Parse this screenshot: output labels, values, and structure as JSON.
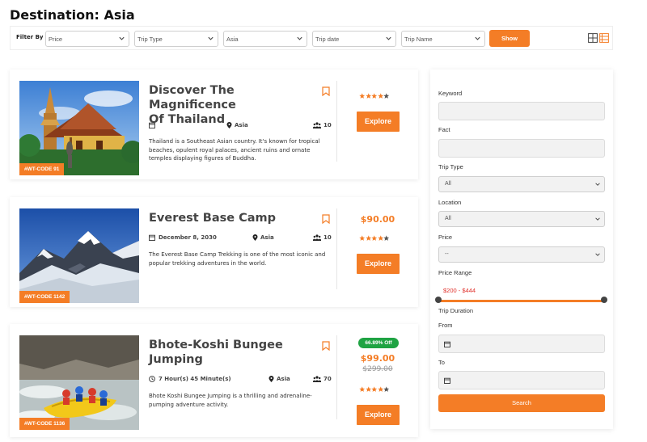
{
  "page": {
    "title": "Destination: Asia"
  },
  "filter_bar": {
    "label": "Filter By",
    "selects": [
      {
        "value": "Price"
      },
      {
        "value": "Trip Type"
      },
      {
        "value": "Asia"
      },
      {
        "value": "Trip date"
      },
      {
        "value": "Trip Name"
      }
    ],
    "show_label": "Show",
    "view_icons": [
      "grid-view-icon",
      "list-view-icon"
    ]
  },
  "colors": {
    "accent": "#f47d26",
    "discount": "#1fa343",
    "range_value": "#e0302a"
  },
  "trips": [
    {
      "title_line1": "Discover The Magnificence",
      "title_line2": "Of Thailand",
      "date": "",
      "location": "Asia",
      "group_size": "10",
      "description": "Thailand is a Southeast Asian country. It's known for tropical beaches, opulent royal palaces, ancient ruins and ornate temples displaying figures of Buddha.",
      "code": "#WT-CODE 91",
      "price": "",
      "old_price": "",
      "discount": "",
      "rating": 4,
      "explore_label": "Explore"
    },
    {
      "title_line1": "Everest Base Camp",
      "title_line2": "",
      "date": "December 8, 2030",
      "location": "Asia",
      "group_size": "10",
      "description": "The Everest Base Camp Trekking is one of the most iconic and popular trekking adventures in the world.",
      "code": "#WT-CODE 1142",
      "price": "$90.00",
      "old_price": "",
      "discount": "",
      "rating": 4,
      "explore_label": "Explore"
    },
    {
      "title_line1": "Bhote-Koshi Bungee",
      "title_line2": "Jumping",
      "date": "7 Hour(s) 45 Minute(s)",
      "location": "Asia",
      "group_size": "70",
      "description": "Bhote Koshi Bungee Jumping is a thrilling and adrenaline-pumping adventure activity.",
      "code": "#WT-CODE 1136",
      "price": "$99.00",
      "old_price": "$299.00",
      "discount": "66.89% Off",
      "rating": 4,
      "explore_label": "Explore"
    }
  ],
  "sidebar": {
    "keyword_label": "Keyword",
    "fact_label": "Fact",
    "trip_type_label": "Trip Type",
    "trip_type_value": "All",
    "location_label": "Location",
    "location_value": "All",
    "price_label": "Price",
    "price_value": "--",
    "price_range_label": "Price Range",
    "price_range_value": "$200 - $444",
    "trip_duration_label": "Trip Duration",
    "from_label": "From",
    "to_label": "To",
    "search_label": "Search"
  }
}
